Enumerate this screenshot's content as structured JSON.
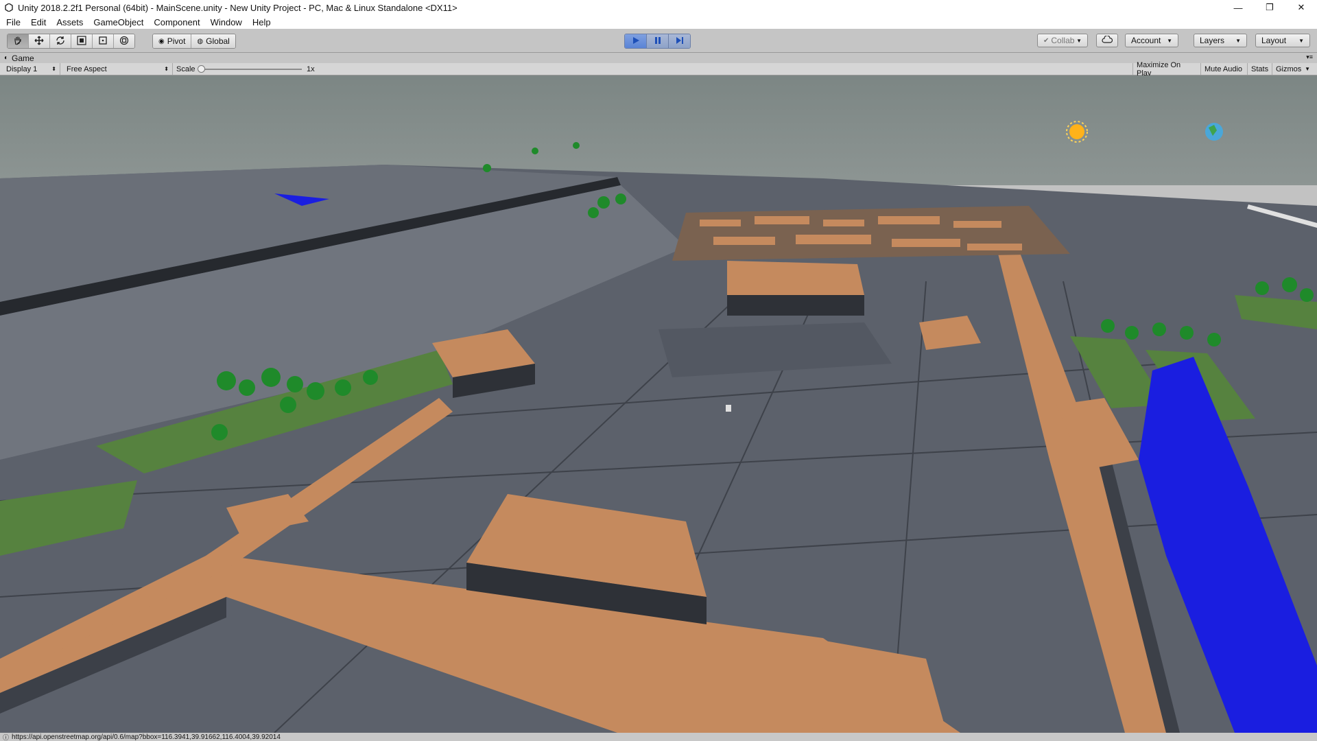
{
  "window": {
    "title": "Unity 2018.2.2f1 Personal (64bit) - MainScene.unity - New Unity Project - PC, Mac & Linux Standalone <DX11>",
    "minimize_glyph": "—",
    "maximize_glyph": "❐",
    "close_glyph": "✕"
  },
  "menu": {
    "items": [
      "File",
      "Edit",
      "Assets",
      "GameObject",
      "Component",
      "Window",
      "Help"
    ]
  },
  "toolbar": {
    "pivot_label": "Pivot",
    "global_label": "Global",
    "collab_label": "Collab",
    "account_label": "Account",
    "layers_label": "Layers",
    "layout_label": "Layout"
  },
  "game_tab": {
    "label": "Game"
  },
  "game_bar": {
    "display_label": "Display 1",
    "aspect_label": "Free Aspect",
    "scale_label": "Scale",
    "scale_value": "1x",
    "maximize_label": "Maximize On Play",
    "mute_label": "Mute Audio",
    "stats_label": "Stats",
    "gizmos_label": "Gizmos"
  },
  "status": {
    "message": "https://api.openstreetmap.org/api/0.6/map?bbox=116.3941,39.91662,116.4004,39.92014"
  },
  "colors": {
    "sky": "#7f8a88",
    "ground": "#5b606a",
    "roof": "#c58a5e",
    "building_side": "#3c4048",
    "grass": "#56823f",
    "tree": "#1f8a2a",
    "water": "#1a1ee0",
    "play_active": "#2f6fd6"
  }
}
